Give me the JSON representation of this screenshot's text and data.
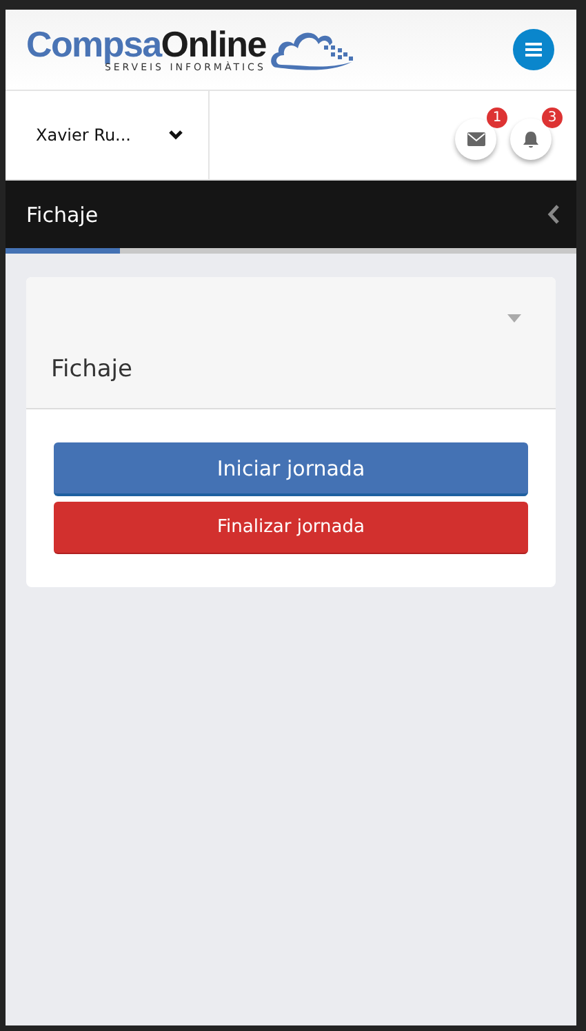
{
  "logo": {
    "name_first": "Compsa",
    "name_second": "Online",
    "tagline": "SERVEIS INFORMÀTICS"
  },
  "user": {
    "name": "Xavier Ru..."
  },
  "notifications": [
    {
      "kind": "mail",
      "count": "1"
    },
    {
      "kind": "bell",
      "count": "3"
    }
  ],
  "page_bar": {
    "title": "Fichaje",
    "level": 0.2
  },
  "card": {
    "title": "Fichaje",
    "buttons": [
      {
        "label": "Iniciar jornada",
        "kind": "primary"
      },
      {
        "label": "Finalizar jornada",
        "kind": "danger"
      }
    ]
  }
}
